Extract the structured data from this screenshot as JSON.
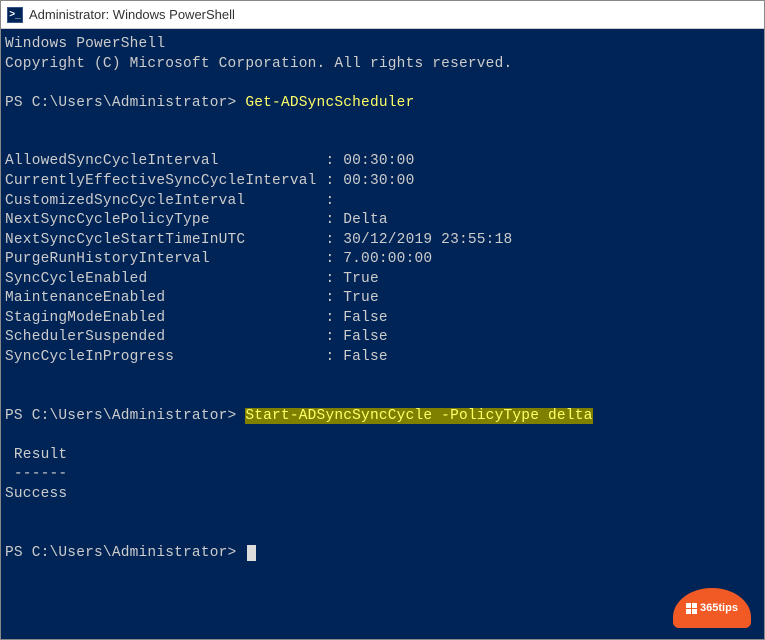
{
  "window": {
    "title": "Administrator: Windows PowerShell",
    "icon_glyph": ">_"
  },
  "terminal": {
    "header_lines": [
      "Windows PowerShell",
      "Copyright (C) Microsoft Corporation. All rights reserved."
    ],
    "prompt_text": "PS C:\\Users\\Administrator> ",
    "command1": "Get-ADSyncScheduler",
    "properties": [
      {
        "name": "AllowedSyncCycleInterval",
        "value": "00:30:00"
      },
      {
        "name": "CurrentlyEffectiveSyncCycleInterval",
        "value": "00:30:00"
      },
      {
        "name": "CustomizedSyncCycleInterval",
        "value": ""
      },
      {
        "name": "NextSyncCyclePolicyType",
        "value": "Delta"
      },
      {
        "name": "NextSyncCycleStartTimeInUTC",
        "value": "30/12/2019 23:55:18"
      },
      {
        "name": "PurgeRunHistoryInterval",
        "value": "7.00:00:00"
      },
      {
        "name": "SyncCycleEnabled",
        "value": "True"
      },
      {
        "name": "MaintenanceEnabled",
        "value": "True"
      },
      {
        "name": "StagingModeEnabled",
        "value": "False"
      },
      {
        "name": "SchedulerSuspended",
        "value": "False"
      },
      {
        "name": "SyncCycleInProgress",
        "value": "False"
      }
    ],
    "prop_name_width": 35,
    "command2": "Start-ADSyncSyncCycle -PolicyType delta",
    "result_header": " Result",
    "result_divider": " ------",
    "result_value": "Success"
  },
  "watermark": {
    "text": "365tips"
  }
}
